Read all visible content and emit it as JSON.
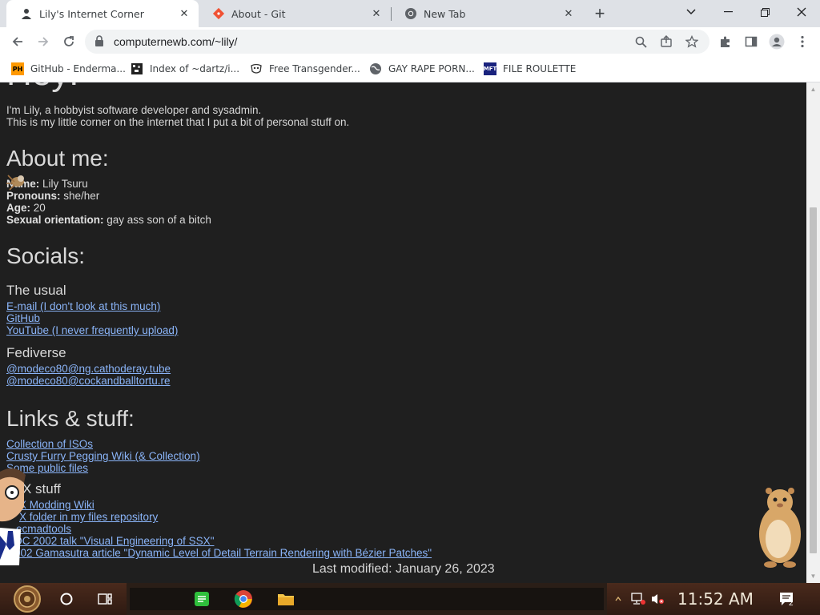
{
  "tabs": [
    {
      "title": "Lily's Internet Corner",
      "icon": "user-icon",
      "active": true
    },
    {
      "title": "About - Git",
      "icon": "git-icon",
      "active": false
    },
    {
      "title": "New Tab",
      "icon": "chrome-icon",
      "active": false
    }
  ],
  "address": {
    "url": "computernewb.com/~lily/"
  },
  "bookmarks": [
    {
      "label": "GitHub - Enderma...",
      "icon": "ph-icon"
    },
    {
      "label": "Index of ~dartz/i...",
      "icon": "pixel-art-icon"
    },
    {
      "label": "Free Transgender...",
      "icon": "mask-icon"
    },
    {
      "label": "GAY RAPE PORN...",
      "icon": "globe-icon"
    },
    {
      "label": "FILE ROULETTE",
      "icon": "mft-icon"
    }
  ],
  "page": {
    "partial_heading": "Hey!",
    "intro_1": "I'm Lily, a hobbyist software developer and sysadmin.",
    "intro_2": "This is my little corner on the internet that I put a bit of personal stuff on.",
    "about": {
      "heading": "About me:",
      "rows": [
        {
          "key": "Name:",
          "value": " Lily Tsuru"
        },
        {
          "key": "Pronouns:",
          "value": " she/her"
        },
        {
          "key": "Age:",
          "value": " 20"
        },
        {
          "key": "Sexual orientation:",
          "value": " gay ass son of a bitch"
        }
      ]
    },
    "socials": {
      "heading": "Socials:",
      "usual_heading": "The usual",
      "usual_links": [
        "E-mail (I don't look at this much)",
        "GitHub",
        "YouTube (I never frequently upload)"
      ],
      "fedi_heading": "Fediverse",
      "fedi_links": [
        "@modeco80@ng.cathoderay.tube",
        "@modeco80@cockandballtortu.re"
      ]
    },
    "links": {
      "heading": "Links & stuff:",
      "items": [
        "Collection of ISOs",
        "Crusty Furry Pegging Wiki (& Collection)",
        "Some public files"
      ],
      "ssx_heading": "X stuff",
      "ssx_items": [
        "X Modding Wiki",
        "X folder in my files repository",
        "ecmadtools",
        "DC 2002 talk \"Visual Engineering of SSX\"",
        "002 Gamasutra article \"Dynamic Level of Detail Terrain Rendering with Bézier Patches\""
      ]
    },
    "last_modified": "Last modified: January 26, 2023"
  },
  "taskbar": {
    "clock": "11:52 AM",
    "notifications": "2"
  }
}
